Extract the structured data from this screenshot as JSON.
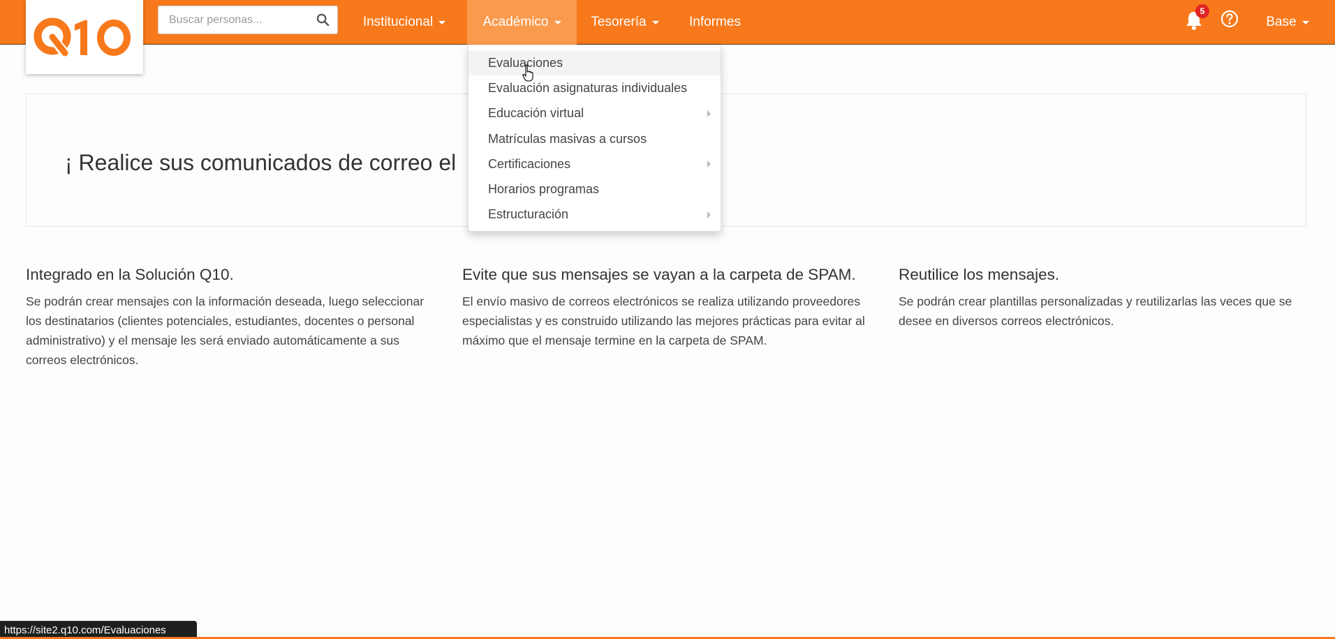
{
  "brand": {
    "logo_text": "Q10",
    "color": "#f8791b"
  },
  "search": {
    "placeholder": "Buscar personas..."
  },
  "nav": {
    "items": [
      {
        "label": "Institucional",
        "has_caret": true
      },
      {
        "label": "Académico",
        "has_caret": true,
        "active": true
      },
      {
        "label": "Tesorería",
        "has_caret": true
      },
      {
        "label": "Informes",
        "has_caret": false
      }
    ],
    "notifications_count": "5",
    "user_label": "Base"
  },
  "dropdown": {
    "items": [
      {
        "label": "Evaluaciones",
        "submenu": false,
        "hover": true
      },
      {
        "label": "Evaluación asignaturas individuales",
        "submenu": false
      },
      {
        "label": "Educación virtual",
        "submenu": true
      },
      {
        "label": "Matrículas masivas a cursos",
        "submenu": false
      },
      {
        "label": "Certificaciones",
        "submenu": true
      },
      {
        "label": "Horarios programas",
        "submenu": false
      },
      {
        "label": "Estructuración",
        "submenu": true
      }
    ]
  },
  "hero": {
    "title": "¡ Realice sus comunicados de correo el"
  },
  "features": [
    {
      "title": "Integrado en la Solución Q10.",
      "text": "Se podrán crear mensajes con la información deseada, luego seleccionar los destinatarios (clientes potenciales, estudiantes, docentes o personal administrativo) y el mensaje les será enviado automáticamente a sus correos electrónicos."
    },
    {
      "title": "Evite que sus mensajes se vayan a la carpeta de SPAM.",
      "text": "El envío masivo de correos electrónicos se realiza utilizando proveedores especialistas y es construido utilizando las mejores prácticas para evitar al máximo que el mensaje termine en la carpeta de SPAM."
    },
    {
      "title": "Reutilice los mensajes.",
      "text": "Se podrán crear plantillas personalizadas y reutilizarlas las veces que se desee en diversos correos electrónicos."
    }
  ],
  "status_url": "https://site2.q10.com/Evaluaciones"
}
